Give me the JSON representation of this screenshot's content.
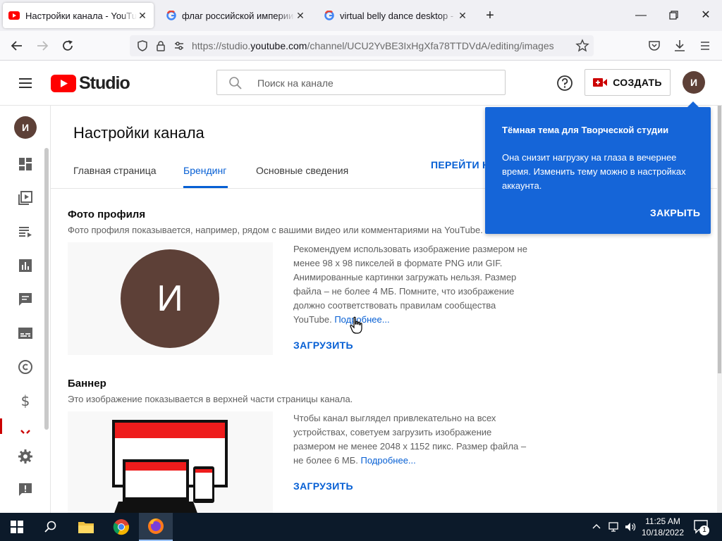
{
  "browser": {
    "tabs": [
      {
        "title": "Настройки канала - YouTube Studio",
        "active": true
      },
      {
        "title": "флаг российской империи – Google",
        "active": false
      },
      {
        "title": "virtual belly dance desktop - Поиск",
        "active": false
      }
    ],
    "url_prefix": "https://studio.",
    "url_domain": "youtube.com",
    "url_path": "/channel/UCU2YvBE3IxHgXfa78TTDVdA/editing/images"
  },
  "header": {
    "logo_text": "Studio",
    "search_placeholder": "Поиск на канале",
    "create_label": "СОЗДАТЬ",
    "avatar_letter": "И"
  },
  "sidebar": {
    "avatar_letter": "И",
    "items": [
      "dashboard-icon",
      "content-icon",
      "playlists-icon",
      "analytics-icon",
      "comments-icon",
      "subtitles-icon",
      "copyright-icon",
      "monetization-icon",
      "customization-icon",
      "settings-icon",
      "feedback-icon"
    ]
  },
  "page": {
    "title": "Настройки канала",
    "tabs": [
      "Главная страница",
      "Брендинг",
      "Основные сведения"
    ],
    "selected_tab": "Брендинг",
    "goto_link": "ПЕРЕЙТИ НА КАНАЛ"
  },
  "profile_photo": {
    "title": "Фото профиля",
    "description": "Фото профиля показывается, например, рядом с вашими видео или комментариями на YouTube.",
    "avatar_letter": "И",
    "recommendation": "Рекомендуем использовать изображение размером не менее 98 x 98 пикселей в формате PNG или GIF. Анимированные картинки загружать нельзя. Размер файла – не более 4 МБ. Помните, что изображение должно соответствовать правилам сообщества YouTube.",
    "more_link": "Подробнее...",
    "upload_label": "ЗАГРУЗИТЬ"
  },
  "banner": {
    "title": "Баннер",
    "description": "Это изображение показывается в верхней части страницы канала.",
    "recommendation": "Чтобы канал выглядел привлекательно на всех устройствах, советуем загрузить изображение размером не менее 2048 x 1152 пикс. Размер файла – не более 6 МБ.",
    "more_link": "Подробнее...",
    "upload_label": "ЗАГРУЗИТЬ"
  },
  "tooltip": {
    "title": "Тёмная тема для Творческой студии",
    "body": "Она снизит нагрузку на глаза в вечернее время. Изменить тему можно в настройках аккаунта.",
    "close_label": "ЗАКРЫТЬ"
  },
  "taskbar": {
    "time": "11:25 AM",
    "date": "10/18/2022",
    "notification_count": "1"
  },
  "colors": {
    "youtube_red": "#ff0000",
    "link_blue": "#065fd4",
    "tooltip_blue": "#1565d8",
    "avatar_brown": "#5d4037",
    "taskbar": "#0c1a2a"
  }
}
